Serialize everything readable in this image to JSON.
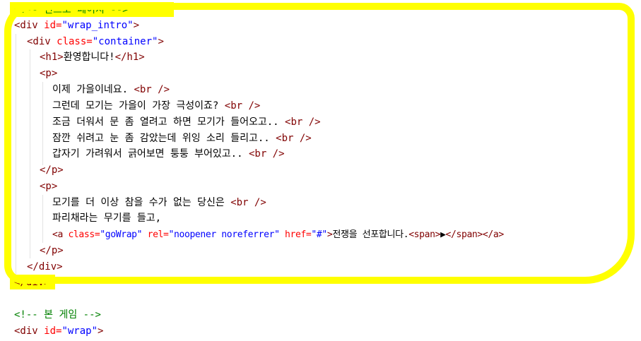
{
  "code": {
    "intro_comment": "<!-- 인트로 페이지 -->",
    "div_open_start": "<div",
    "id_attr": " id=",
    "wrap_intro_val": "\"wrap_intro\"",
    "close_angle": ">",
    "container_open_start": "<div",
    "class_attr": " class=",
    "container_val": "\"container\"",
    "h1_open": "<h1>",
    "h1_text": "환영합니다!",
    "h1_close": "</h1>",
    "p_open": "<p>",
    "p_close": "</p>",
    "br": "<br />",
    "para1_lines": [
      "이제 가을이네요. ",
      "그런데 모기는 가을이 가장 극성이죠? ",
      "조금 더워서 문 좀 열려고 하면 모기가 들어오고.. ",
      "잠깐 쉬려고 눈 좀 감았는데 위잉 소리 들리고.. ",
      "갑자기 가려워서 긁어보면 퉁퉁 부어있고.. "
    ],
    "para2_line1": "모기를 더 이상 참을 수가 없는 당신은 ",
    "para2_line2": "파리채라는 무기를 들고,",
    "a_open_start": "<a",
    "rel_attr": " rel=",
    "href_attr": " href=",
    "gowrap_val": "\"goWrap\"",
    "rel_val": "\"noopener noreferrer\"",
    "href_val": "\"#\"",
    "a_text": "전쟁을 선포합니다.",
    "span_open": "<span>",
    "span_text": "▶",
    "span_close": "</span>",
    "a_close": "</a>",
    "div_close": "</div>",
    "game_comment": "<!-- 본 게임 -->",
    "wrap_val": "\"wrap\""
  },
  "colors": {
    "highlight": "#ffff00",
    "comment": "#008000",
    "tag": "#800000",
    "attribute": "#ff0000",
    "string": "#0000ff"
  }
}
